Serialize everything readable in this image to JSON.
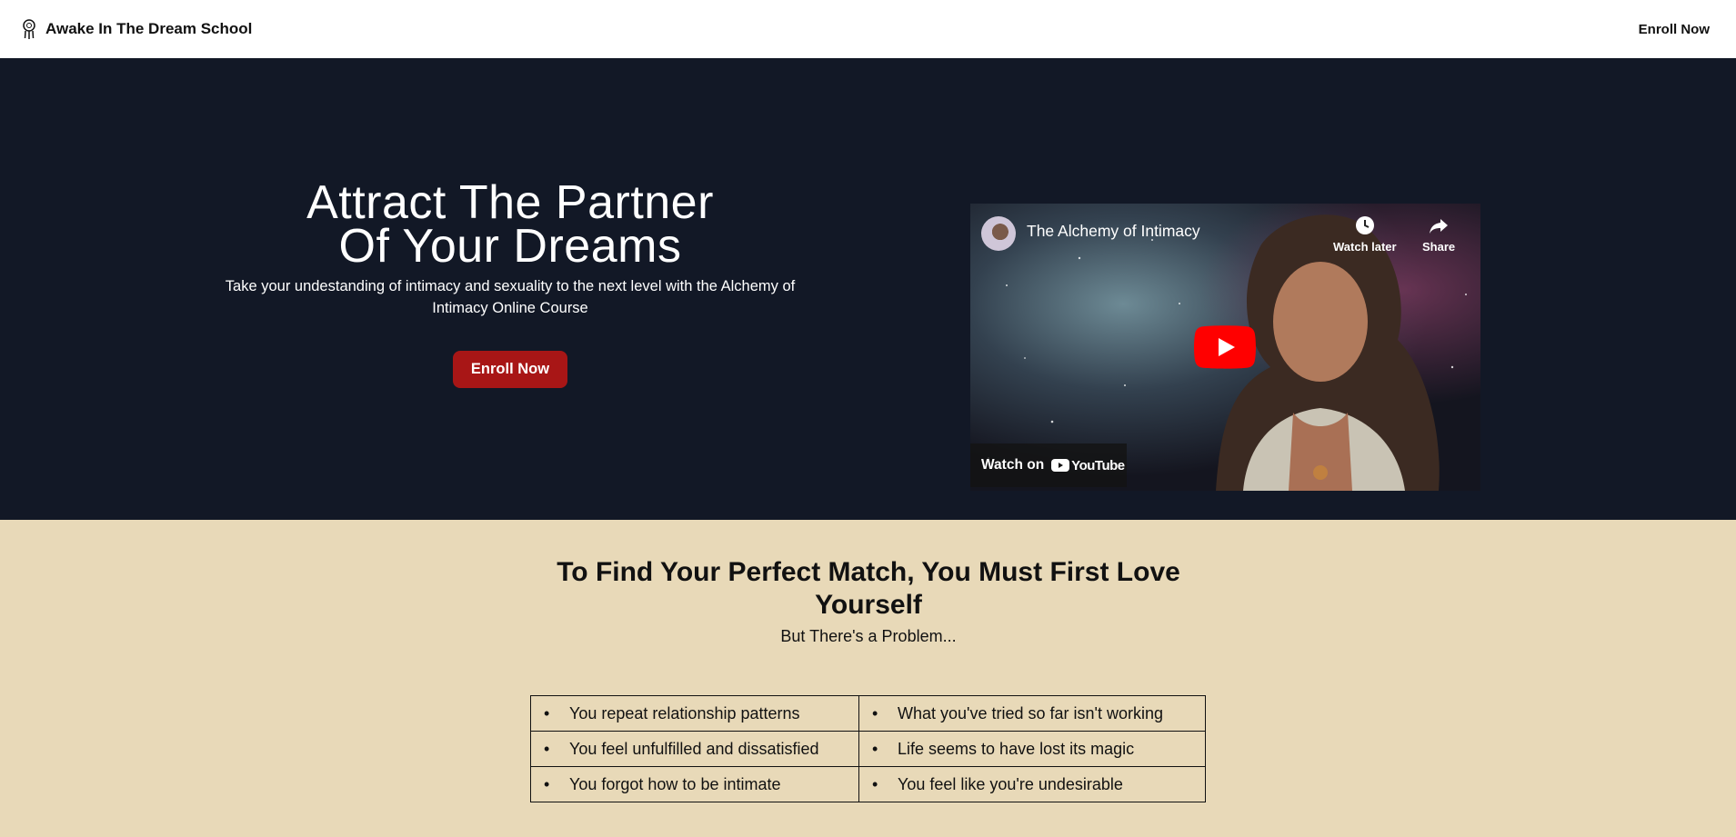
{
  "header": {
    "brand_name": "Awake In The Dream School",
    "logo_icon": "dreamcatcher-icon",
    "enroll_label": "Enroll Now"
  },
  "hero": {
    "title_line1": "Attract The Partner",
    "title_line2": "Of Your Dreams",
    "subtitle": "Take your undestanding of intimacy and sexuality to the next level with the Alchemy of Intimacy Online Course",
    "cta_label": "Enroll Now",
    "background_color": "#121826",
    "cta_color": "#a81616"
  },
  "video": {
    "title": "The Alchemy of Intimacy",
    "watch_later_label": "Watch later",
    "share_label": "Share",
    "watch_on_label": "Watch on",
    "platform_label": "YouTube",
    "play_icon": "play-icon"
  },
  "problem_section": {
    "title": "To Find Your Perfect Match, You Must First Love Yourself",
    "subtitle": "But There's a Problem...",
    "background_color": "#e8d9b8",
    "rows": [
      [
        "You repeat relationship patterns",
        "What you've tried so far isn't working"
      ],
      [
        "You feel unfulfilled and dissatisfied",
        "Life seems to have lost its magic"
      ],
      [
        "You forgot how to be intimate",
        "You feel like you're undesirable"
      ]
    ]
  }
}
